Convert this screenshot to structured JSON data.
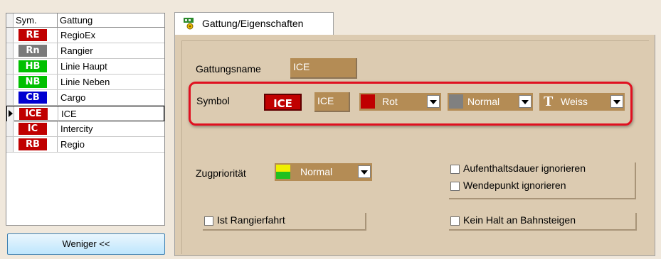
{
  "table": {
    "header_sym": "Sym.",
    "header_gattung": "Gattung",
    "rows": [
      {
        "sym": "RE",
        "color": "#c00000",
        "name": "RegioEx"
      },
      {
        "sym": "Rn",
        "color": "#7a7a7a",
        "name": "Rangier"
      },
      {
        "sym": "HB",
        "color": "#00c000",
        "name": "Linie Haupt"
      },
      {
        "sym": "NB",
        "color": "#00c000",
        "name": "Linie Neben"
      },
      {
        "sym": "CB",
        "color": "#0000d0",
        "name": "Cargo"
      },
      {
        "sym": "ICE",
        "color": "#c00000",
        "name": "ICE",
        "selected": true
      },
      {
        "sym": "IC",
        "color": "#c00000",
        "name": "Intercity"
      },
      {
        "sym": "RB",
        "color": "#c00000",
        "name": "Regio"
      }
    ]
  },
  "weniger_label": "Weniger <<",
  "tab": {
    "label": "Gattung/Eigenschaften"
  },
  "form": {
    "gattungsname_label": "Gattungsname",
    "gattungsname_value": "ICE",
    "symbol_label": "Symbol",
    "symbol_preview": "ICE",
    "symbol_text": "ICE",
    "color_value": "Rot",
    "style_value": "Normal",
    "text_color_icon": "T",
    "text_color_value": "Weiss",
    "zugprioritaet_label": "Zugpriorität",
    "zugprioritaet_value": "Normal",
    "aufenthalt_label": "Aufenthaltsdauer ignorieren",
    "wendepunkt_label": "Wendepunkt ignorieren",
    "rangierfahrt_label": "Ist Rangierfahrt",
    "kein_halt_label": "Kein Halt an Bahnsteigen"
  },
  "colors": {
    "rot": "#c00000",
    "grey": "#808080",
    "accent_red": "#e01020"
  }
}
